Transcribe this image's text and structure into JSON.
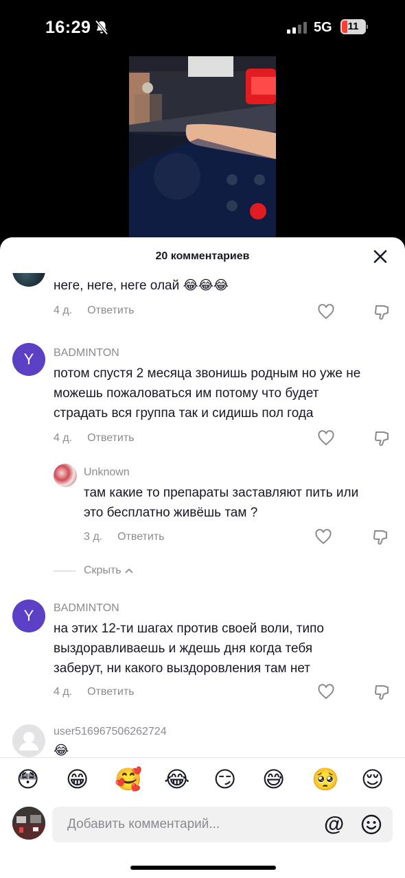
{
  "status_bar": {
    "time": "16:29",
    "network": "5G",
    "battery": "11"
  },
  "sheet": {
    "title": "20 комментариев"
  },
  "comments": [
    {
      "text": "неге, неге, неге олай 😂😂😂",
      "age": "4 д.",
      "reply_label": "Ответить"
    },
    {
      "username": "BADMINTON",
      "avatar_letter": "Y",
      "text_lines": [
        "потом спустя 2 месяца звонишь родным но уже не",
        "можешь пожаловаться им потому что будет",
        "страдать вся группа так и сидишь пол года"
      ],
      "age": "4 д.",
      "reply_label": "Ответить"
    },
    {
      "username": "Unknown",
      "text_lines": [
        "там какие то препараты заставляют пить или",
        "это бесплатно живёшь там ?"
      ],
      "age": "3 д.",
      "reply_label": "Ответить"
    },
    {
      "username": "BADMINTON",
      "avatar_letter": "Y",
      "text_lines": [
        "на этих 12-ти шагах против своей воли, типо",
        "выздоравливаешь и ждешь дня когда тебя",
        "заберут, ни какого выздоровления там нет"
      ],
      "age": "4 д.",
      "reply_label": "Ответить"
    },
    {
      "username": "user516967506262724",
      "text": "😂"
    }
  ],
  "hide_replies_label": "Скрыть",
  "emoji_bar": [
    "😳",
    "😁",
    "🥰",
    "😂",
    "😏",
    "😅",
    "🥺",
    "😌"
  ],
  "input": {
    "placeholder": "Добавить комментарий...",
    "at_symbol": "@"
  },
  "colors": {
    "accent_avatar": "#5b3fc4",
    "muted_text": "#8a8b91",
    "primary_text": "#161823"
  }
}
